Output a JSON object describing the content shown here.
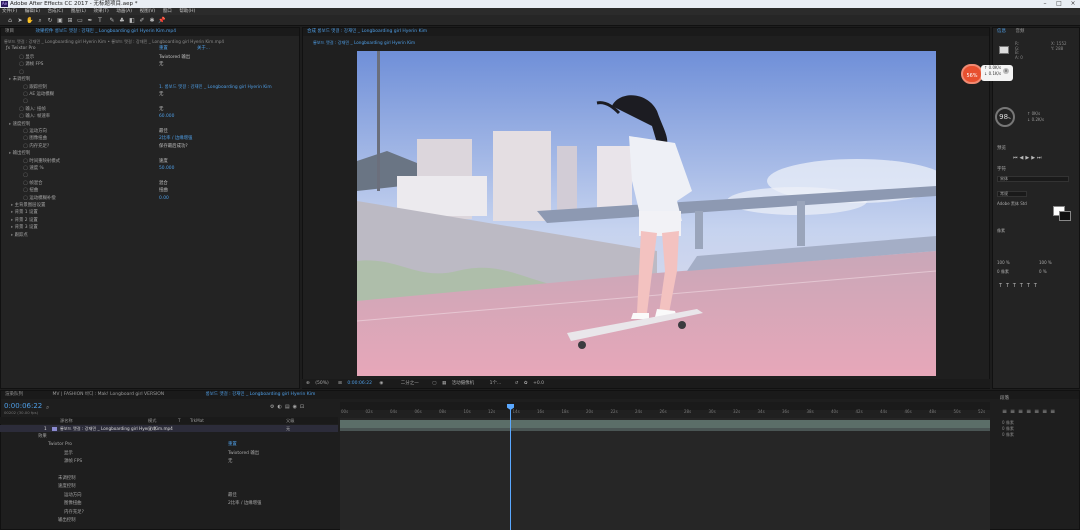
{
  "window": {
    "title": "Adobe After Effects CC 2017 - 无标题项目.aep *",
    "app_icon": "Ae"
  },
  "menu": [
    "文件(F)",
    "编辑(E)",
    "合成(C)",
    "图层(L)",
    "效果(T)",
    "动画(A)",
    "视图(V)",
    "窗口",
    "帮助(H)"
  ],
  "toolbar": {
    "snap_label": "对齐",
    "workspace": "默认",
    "search_placeholder": "搜索帮助"
  },
  "effects_panel": {
    "tabs": [
      "项目",
      "效果控件 롱보드 맷걸 : 강재민 _ Longboarding girl Hyerin Kim.mp4"
    ],
    "breadcrumb": "롱보드 맷걸 : 강재민 _ Longboarding girl Hyerin Kim • 롱보드 맷걸 : 강재민 _ Longboarding girl Hyerin Kim.mp4",
    "effect_name": "Twixtor Pro",
    "reset": "重置",
    "about": "关于...",
    "rows": [
      {
        "label": "显示",
        "value": "Twixtored 输出"
      },
      {
        "label": "源帧 FPS",
        "value": "无"
      },
      {
        "label": "",
        "value": ""
      },
      {
        "label": "未调控制",
        "value": ""
      },
      {
        "label": "跟踪控制",
        "value": "1. 롱보드 맷걸 : 강재민 _ Longboarding girl Hyerin Kim"
      },
      {
        "label": "AE 运动模糊",
        "value": "无"
      },
      {
        "label": "",
        "value": ""
      },
      {
        "label": "输入: 扭帧",
        "value": "无"
      },
      {
        "label": "输入: 帧速率",
        "value": "60.000"
      },
      {
        "label": "速度控制",
        "value": ""
      },
      {
        "label": "运动方向",
        "value": "最佳"
      },
      {
        "label": "图像扭曲",
        "value": "2比率 / 边缘增强"
      },
      {
        "label": "内存充足?",
        "value": "保存最后成功?"
      },
      {
        "label": "输出控制",
        "value": ""
      },
      {
        "label": "时间重映射模式",
        "value": "速度"
      },
      {
        "label": "速度 %",
        "value": "50.000"
      },
      {
        "label": "",
        "value": ""
      },
      {
        "label": "帧混合",
        "value": "混合"
      },
      {
        "label": "扭曲",
        "value": "扭曲"
      },
      {
        "label": "运动模糊补偿",
        "value": "0.00"
      },
      {
        "label": "主背景图层设置",
        "value": ""
      },
      {
        "label": "背景 1 设置",
        "value": ""
      },
      {
        "label": "背景 2 设置",
        "value": ""
      },
      {
        "label": "背景 3 设置",
        "value": ""
      },
      {
        "label": "跟踪点",
        "value": ""
      }
    ]
  },
  "comp_viewer": {
    "tabs": [
      "合成 롱보드 맷걸 : 강재민 _ Longboarding girl Hyerin Kim"
    ],
    "breadcrumb": [
      "롱보드 맷걸 : 강재민 _ Longboarding girl Hyerin Kim"
    ],
    "footer": {
      "zoom": "(50%)",
      "time": "0:00:06:22",
      "resolution": "二分之一",
      "camera": "活动摄像机",
      "views": "1个...",
      "exposure": "+0.0"
    }
  },
  "info_panel": {
    "tabs": [
      "信息",
      "音频"
    ],
    "values": [
      "R:",
      "G:",
      "B:",
      "A: 0",
      "X: 1552",
      "Y: 288"
    ],
    "speed_badge": "56%",
    "net_up": "0.0K/s",
    "net_down": "0.1K/s",
    "perf": "98",
    "perf_unit": "%",
    "ok_up": "0K/s",
    "ok_down": "0.2K/s"
  },
  "preview_panel": {
    "title": "预览"
  },
  "character_panel": {
    "title": "字符",
    "font": "宋体",
    "style": "常规",
    "font_size": "Adobe 黑体 Std",
    "tracking": "像素",
    "scale_v": "100 %",
    "scale_h": "100 %",
    "baseline": "0 像素",
    "tsume": "0 %"
  },
  "align_panel": {
    "title": "段落",
    "indent_lbl": [
      "0 像素",
      "0 像素",
      "0 像素"
    ]
  },
  "timeline": {
    "tabs": [
      "渲染队列",
      "MV | FASHION 바디 : Mak! Longboard girl VERSION",
      "롱보드 맷걸 : 강재민 _ Longboarding girl Hyerin Kim"
    ],
    "timecode": "0:00:06:22",
    "fps_info": "00202 (30.00 fps)",
    "columns": [
      "源名称",
      "模式",
      "T",
      "TrkMat",
      "父级"
    ],
    "layer_name": "롱보드 맷걸 : 강재민 _ Longboarding girl Hyerin Kim.mp4",
    "layer_mode": "正常",
    "layer_parent": "无",
    "sub_rows": [
      "效果",
      "Twixtor Pro",
      "显示",
      "源帧 FPS",
      "",
      "未调控制",
      "速度控制",
      "运动方向",
      "图像扭曲",
      "内存充足?",
      "输出控制"
    ],
    "sub_values": [
      "",
      "重置",
      "Twixtored 输出",
      "无",
      "",
      "",
      "",
      "最佳",
      "2比率 / 边缘增强",
      "",
      ""
    ],
    "ruler": [
      "00s",
      "02s",
      "04s",
      "06s",
      "08s",
      "10s",
      "12s",
      "14s",
      "16s",
      "18s",
      "20s",
      "22s",
      "24s",
      "26s",
      "28s",
      "30s",
      "32s",
      "34s",
      "36s",
      "38s",
      "40s",
      "42s",
      "44s",
      "46s",
      "48s",
      "50s",
      "52s"
    ]
  },
  "colors": {
    "accent": "#4e9ee6",
    "panel": "#232323",
    "timecode": "#4e9ee6",
    "badge": "#e8502f"
  }
}
